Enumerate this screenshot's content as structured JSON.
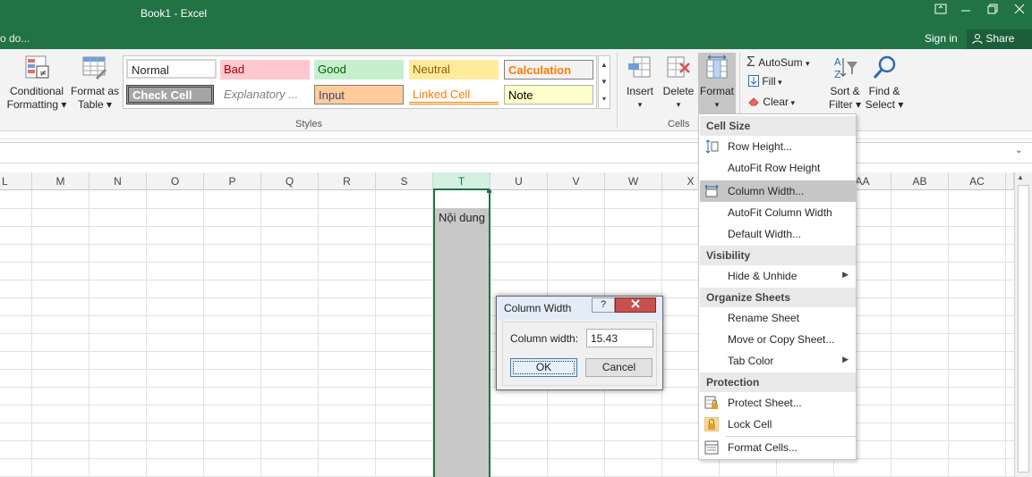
{
  "window": {
    "title": "Book1 - Excel",
    "tell_me": "o do...",
    "sign_in": "Sign in",
    "share": "Share"
  },
  "ribbon": {
    "conditional_formatting": [
      "Conditional",
      "Formatting"
    ],
    "format_as_table": [
      "Format as",
      "Table"
    ],
    "styles": [
      {
        "label": "Normal",
        "bg": "#ffffff",
        "fg": "#000000"
      },
      {
        "label": "Bad",
        "bg": "#ffc7ce",
        "fg": "#9c0006"
      },
      {
        "label": "Good",
        "bg": "#c6efce",
        "fg": "#006100"
      },
      {
        "label": "Neutral",
        "bg": "#ffeb9c",
        "fg": "#9c5700"
      },
      {
        "label": "Calculation",
        "bg": "#f2f2f2",
        "fg": "#fa7d00"
      },
      {
        "label": "Check Cell",
        "bg": "#a5a5a5",
        "fg": "#ffffff"
      },
      {
        "label": "Explanatory ...",
        "bg": "#ffffff",
        "fg": "#7f7f7f"
      },
      {
        "label": "Input",
        "bg": "#ffcc99",
        "fg": "#3f3f76"
      },
      {
        "label": "Linked Cell",
        "bg": "#ffffff",
        "fg": "#fa7d00"
      },
      {
        "label": "Note",
        "bg": "#ffffcc",
        "fg": "#000000"
      }
    ],
    "styles_group": "Styles",
    "insert": "Insert",
    "delete": "Delete",
    "format": "Format",
    "cells_group": "Cells",
    "autosum": "AutoSum",
    "fill": "Fill",
    "clear": "Clear",
    "sort_filter": [
      "Sort &",
      "Filter"
    ],
    "find_select": [
      "Find &",
      "Select"
    ]
  },
  "columns": [
    "L",
    "M",
    "N",
    "O",
    "P",
    "Q",
    "R",
    "S",
    "T",
    "U",
    "V",
    "W",
    "X",
    "AA",
    "AB",
    "AC"
  ],
  "cell_T2": "Nội dung",
  "format_menu": {
    "cell_size": "Cell Size",
    "row_height": "Row Height...",
    "autofit_row": "AutoFit Row Height",
    "column_width": "Column Width...",
    "autofit_column": "AutoFit Column Width",
    "default_width": "Default Width...",
    "visibility": "Visibility",
    "hide_unhide": "Hide & Unhide",
    "organize": "Organize Sheets",
    "rename": "Rename Sheet",
    "move_copy": "Move or Copy Sheet...",
    "tab_color": "Tab Color",
    "protection": "Protection",
    "protect_sheet": "Protect Sheet...",
    "lock_cell": "Lock Cell",
    "format_cells": "Format Cells..."
  },
  "dialog": {
    "title": "Column Width",
    "label": "Column width:",
    "value": "15.43",
    "ok": "OK",
    "cancel": "Cancel"
  }
}
